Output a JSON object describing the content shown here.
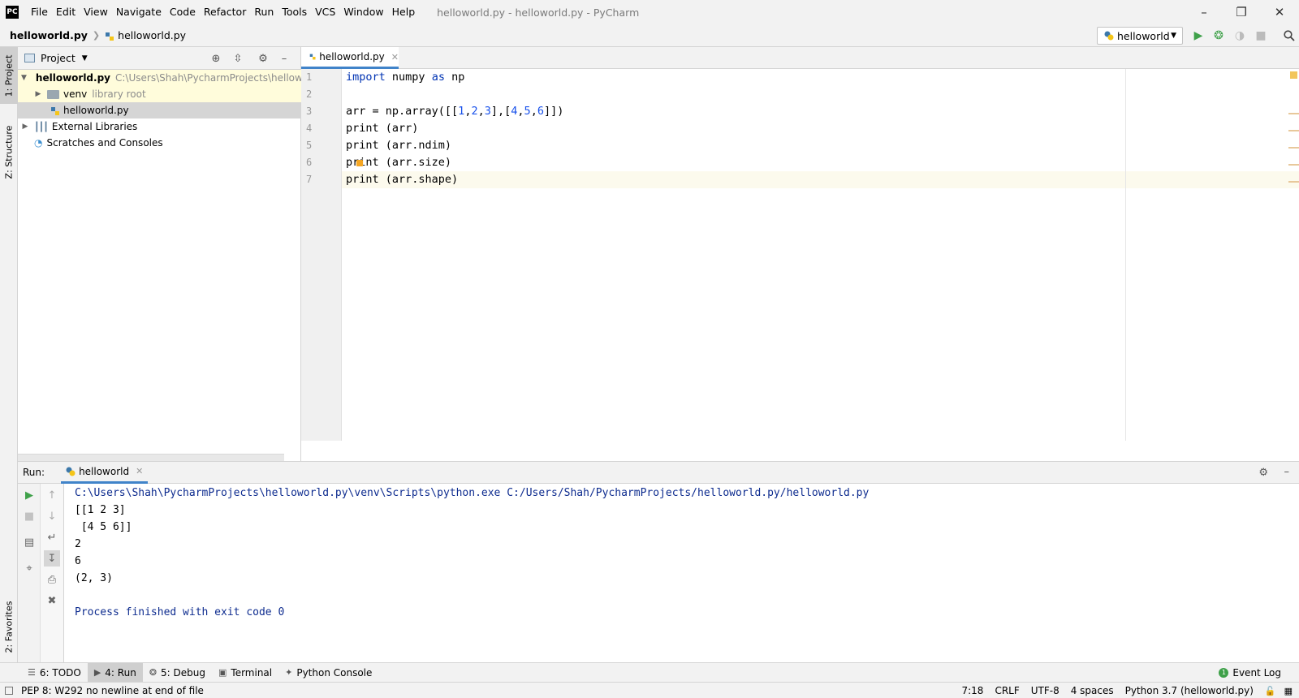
{
  "titlebar": {
    "logo": "PC",
    "menu": [
      "File",
      "Edit",
      "View",
      "Navigate",
      "Code",
      "Refactor",
      "Run",
      "Tools",
      "VCS",
      "Window",
      "Help"
    ],
    "window_title": "helloworld.py - helloworld.py - PyCharm"
  },
  "navbar": {
    "project_crumb": "helloworld.py",
    "file_crumb": "helloworld.py",
    "run_config": "helloworld"
  },
  "left_strip": {
    "project_tab": "1: Project",
    "structure_tab": "Z: Structure",
    "favorites_tab": "2: Favorites"
  },
  "project": {
    "title": "Project",
    "tree": [
      {
        "label": "helloworld.py",
        "hint": "C:\\Users\\Shah\\PycharmProjects\\helloworld.py",
        "expanded": true
      },
      {
        "label": "venv",
        "hint": "library root",
        "expanded": false
      },
      {
        "label": "helloworld.py",
        "hint": ""
      },
      {
        "label": "External Libraries",
        "hint": ""
      },
      {
        "label": "Scratches and Consoles",
        "hint": ""
      }
    ]
  },
  "editor": {
    "tab_label": "helloworld.py",
    "line_numbers": [
      "1",
      "2",
      "3",
      "4",
      "5",
      "6",
      "7"
    ],
    "code": {
      "l1": {
        "kw1": "import",
        "t1": " numpy ",
        "kw2": "as",
        "t2": " np"
      },
      "l3": {
        "t1": "arr = np.array([[",
        "n1": "1",
        "c1": ",",
        "n2": "2",
        "c2": ",",
        "n3": "3",
        "t2": "],[",
        "n4": "4",
        "c3": ",",
        "n5": "5",
        "c4": ",",
        "n6": "6",
        "t3": "]])"
      },
      "l4": "print (arr)",
      "l5": "print (arr.ndim)",
      "l6": "print (arr.size)",
      "l7": "print (arr.shape)"
    }
  },
  "run": {
    "label": "Run:",
    "tab_label": "helloworld",
    "output": [
      "C:\\Users\\Shah\\PycharmProjects\\helloworld.py\\venv\\Scripts\\python.exe C:/Users/Shah/PycharmProjects/helloworld.py/helloworld.py",
      "[[1 2 3]",
      " [4 5 6]]",
      "2",
      "6",
      "(2, 3)",
      "",
      "Process finished with exit code 0"
    ]
  },
  "bottom_tabs": {
    "todo": "6: TODO",
    "run": "4: Run",
    "debug": "5: Debug",
    "terminal": "Terminal",
    "python_console": "Python Console",
    "event_log": "Event Log",
    "event_count": "1"
  },
  "status": {
    "message": "PEP 8: W292 no newline at end of file",
    "position": "7:18",
    "line_sep": "CRLF",
    "encoding": "UTF-8",
    "indent": "4 spaces",
    "interpreter": "Python 3.7 (helloworld.py)"
  },
  "colors": {
    "keyword": "#0033b3",
    "number": "#1750eb",
    "accent_tab": "#4083c9",
    "run_green": "#3fa14a"
  }
}
